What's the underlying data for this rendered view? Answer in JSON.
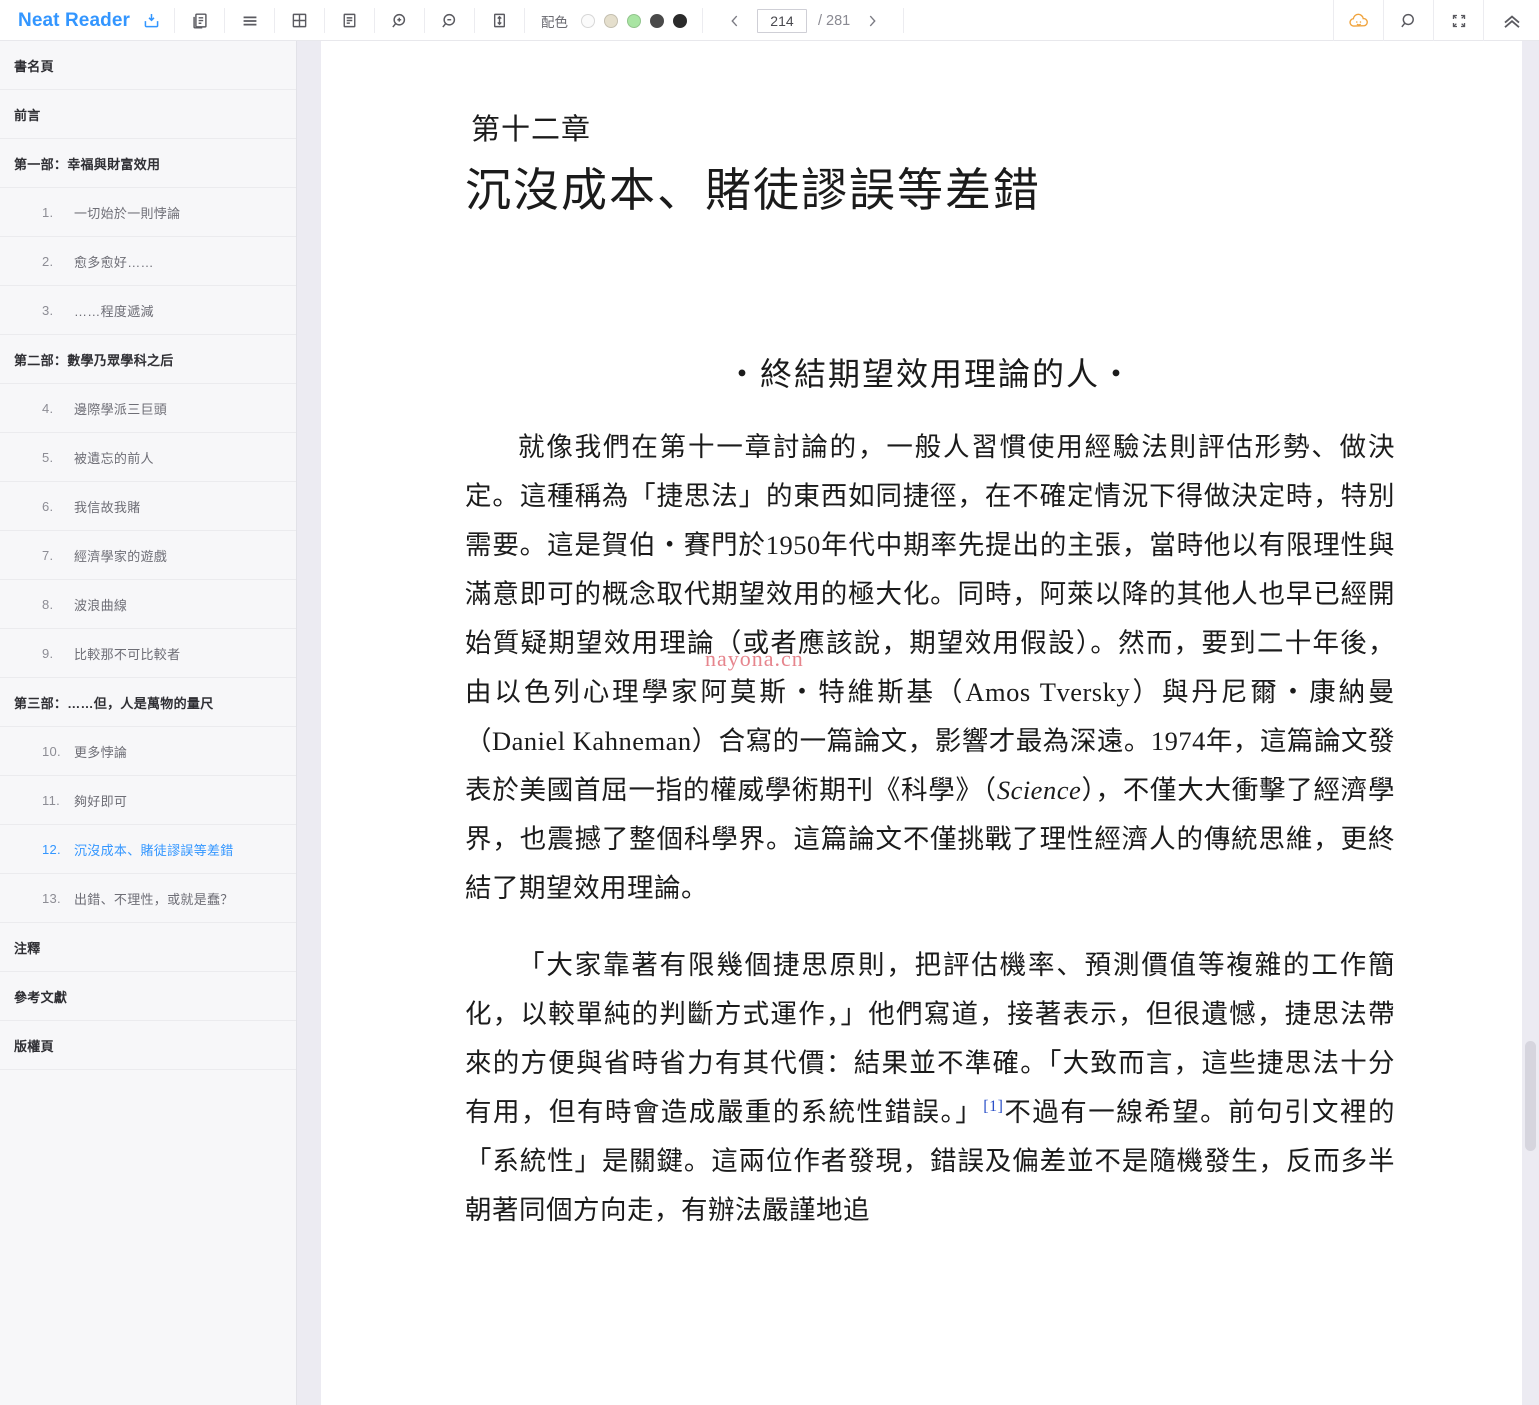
{
  "app": {
    "brand": "Neat Reader",
    "brand_color": "#3396ff"
  },
  "toolbar": {
    "save_icon": "download-icon",
    "buttons": [
      {
        "name": "copy-icon",
        "title": "複製"
      },
      {
        "name": "list-view-icon",
        "title": "目錄"
      },
      {
        "name": "grid-view-icon",
        "title": "雙頁"
      },
      {
        "name": "single-page-icon",
        "title": "單頁"
      },
      {
        "name": "zoom-in-icon",
        "title": "放大"
      },
      {
        "name": "zoom-out-icon",
        "title": "縮小"
      },
      {
        "name": "fit-height-icon",
        "title": "適應高度"
      }
    ],
    "scheme": {
      "label": "配色",
      "swatches": [
        "#fbfbfb",
        "#e5dfcd",
        "#a9e5a3",
        "#4a4a4a",
        "#2b2b2b"
      ],
      "selected_index": 0
    },
    "pager": {
      "prev_icon": "chevron-left-icon",
      "next_icon": "chevron-right-icon",
      "current_page": "214",
      "total_label": "/ 281"
    },
    "right_buttons": [
      {
        "name": "cloud-icon",
        "title": "雲端",
        "color": "#f0a33c"
      },
      {
        "name": "search-icon",
        "title": "搜尋",
        "color": "#5a5a60"
      },
      {
        "name": "fullscreen-icon",
        "title": "全螢幕",
        "color": "#5a5a60"
      },
      {
        "name": "collapse-up-icon",
        "title": "收起",
        "color": "#5a5a60"
      }
    ]
  },
  "sidebar": {
    "items": [
      {
        "level": 0,
        "num": "",
        "label": "書名頁",
        "active": false
      },
      {
        "level": 0,
        "num": "",
        "label": "前言",
        "active": false
      },
      {
        "level": 0,
        "num": "",
        "label": "第一部：幸福與財富效用",
        "active": false
      },
      {
        "level": 1,
        "num": "1.",
        "label": "一切始於一則悖論",
        "active": false
      },
      {
        "level": 1,
        "num": "2.",
        "label": "愈多愈好……",
        "active": false
      },
      {
        "level": 1,
        "num": "3.",
        "label": "……程度遞減",
        "active": false
      },
      {
        "level": 0,
        "num": "",
        "label": "第二部：數學乃眾學科之后",
        "active": false
      },
      {
        "level": 1,
        "num": "4.",
        "label": "邊際學派三巨頭",
        "active": false
      },
      {
        "level": 1,
        "num": "5.",
        "label": "被遺忘的前人",
        "active": false
      },
      {
        "level": 1,
        "num": "6.",
        "label": "我信故我賭",
        "active": false
      },
      {
        "level": 1,
        "num": "7.",
        "label": "經濟學家的遊戲",
        "active": false
      },
      {
        "level": 1,
        "num": "8.",
        "label": "波浪曲線",
        "active": false
      },
      {
        "level": 1,
        "num": "9.",
        "label": "比較那不可比較者",
        "active": false
      },
      {
        "level": 0,
        "num": "",
        "label": "第三部：……但，人是萬物的量尺",
        "active": false
      },
      {
        "level": 1,
        "num": "10.",
        "label": "更多悖論",
        "active": false
      },
      {
        "level": 1,
        "num": "11.",
        "label": "夠好即可",
        "active": false
      },
      {
        "level": 1,
        "num": "12.",
        "label": "沉沒成本、賭徒謬誤等差錯",
        "active": true
      },
      {
        "level": 1,
        "num": "13.",
        "label": "出錯、不理性，或就是蠢？",
        "active": false
      },
      {
        "level": 0,
        "num": "",
        "label": "注釋",
        "active": false
      },
      {
        "level": 0,
        "num": "",
        "label": "參考文獻",
        "active": false
      },
      {
        "level": 0,
        "num": "",
        "label": "版權頁",
        "active": false
      }
    ]
  },
  "content": {
    "chapter_number": "第十二章",
    "chapter_title": "沉沒成本、賭徒謬誤等差錯",
    "section_heading": "・終結期望效用理論的人・",
    "paragraph_1_a": "就像我們在第十一章討論的，一般人習慣使用經驗法則評估形勢、做決定。這種稱為「捷思法」的東西如同捷徑，在不確定情況下得做決定時，特別需要。這是賀伯・賽門於1950年代中期率先提出的主張，當時他以有限理性與滿意即可的概念取代期望效用的極大化。同時，阿萊以降的其他人也早已經開始質疑期望效用理論（或者應該說，期望效用假設）。然而，要到二十年後，由以色列心理學家阿莫斯・特維斯基（Amos Tversky）與丹尼爾・康納曼（Daniel Kahneman）合寫的一篇論文，影響才最為深遠。1974年，這篇論文發表於美國首屈一指的權威學術期刊《科學》（",
    "paragraph_1_italic": "Science",
    "paragraph_1_b": "），不僅大大衝擊了經濟學界，也震撼了整個科學界。這篇論文不僅挑戰了理性經濟人的傳統思維，更終結了期望效用理論。",
    "paragraph_2_a": "「大家靠著有限幾個捷思原則，把評估機率、預測價值等複雜的工作簡化，以較單純的判斷方式運作，」他們寫道，接著表示，但很遺憾，捷思法帶來的方便與省時省力有其代價：結果並不準確。「大致而言，這些捷思法十分有用，但有時會造成嚴重的系統性錯誤。」",
    "paragraph_2_footnote": "[1]",
    "paragraph_2_b": "不過有一線希望。前句引文裡的「系統性」是關鍵。這兩位作者發現，錯誤及偏差並不是隨機發生，反而多半朝著同個方向走，有辦法嚴謹地追",
    "watermark": "nayona.cn"
  }
}
